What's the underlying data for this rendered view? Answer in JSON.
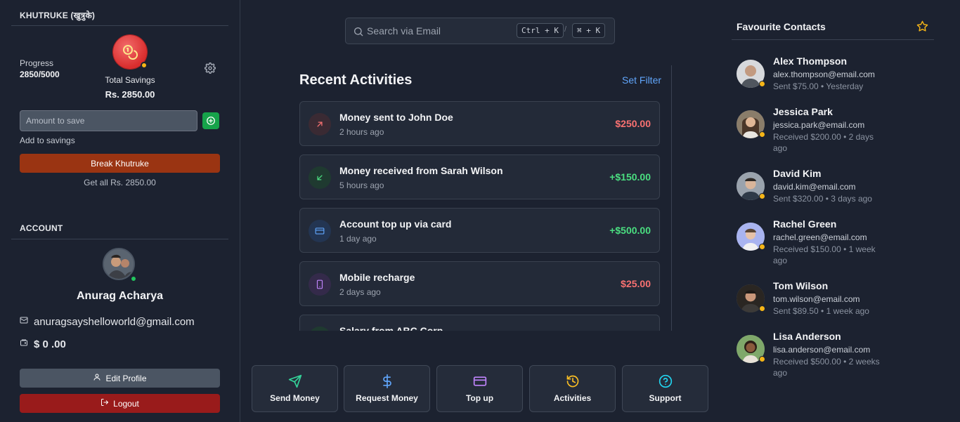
{
  "savings": {
    "section_title": "KHUTRUKE (खुत्रुके)",
    "progress_label": "Progress",
    "progress_value": "2850/5000",
    "total_label": "Total Savings",
    "total_value": "Rs. 2850.00",
    "amount_placeholder": "Amount to save",
    "add_hint": "Add to savings",
    "break_label": "Break Khutruke",
    "get_all": "Get all Rs. 2850.00",
    "coin_color": "#d92d2d"
  },
  "account": {
    "section_title": "ACCOUNT",
    "name": "Anurag Acharya",
    "email": "anuragsayshelloworld@gmail.com",
    "balance": "$ 0 .00",
    "edit_label": "Edit Profile",
    "logout_label": "Logout",
    "online_color": "#22c55e"
  },
  "search": {
    "placeholder": "Search via Email",
    "shortcut_win": "Ctrl + K",
    "shortcut_sep": "/",
    "shortcut_mac": "⌘ + K"
  },
  "recent": {
    "title": "Recent Activities",
    "filter_label": "Set Filter",
    "items": [
      {
        "title": "Money sent to John Doe",
        "time": "2 hours ago",
        "amount": "$250.00",
        "kind": "sent",
        "icon": "arrow-up-right-icon",
        "color": "#f87171"
      },
      {
        "title": "Money received from Sarah Wilson",
        "time": "5 hours ago",
        "amount": "+$150.00",
        "kind": "received",
        "icon": "arrow-down-left-icon",
        "color": "#4ade80"
      },
      {
        "title": "Account top up via card",
        "time": "1 day ago",
        "amount": "+$500.00",
        "kind": "topup",
        "icon": "card-icon",
        "color": "#4ade80"
      },
      {
        "title": "Mobile recharge",
        "time": "2 days ago",
        "amount": "$25.00",
        "kind": "recharge",
        "icon": "mobile-icon",
        "color": "#f87171"
      },
      {
        "title": "Salary from ABC Corp",
        "time": "",
        "amount": "",
        "kind": "received",
        "icon": "arrow-down-left-icon",
        "color": "#4ade80"
      }
    ]
  },
  "quick_actions": [
    {
      "label": "Send Money",
      "icon": "send-icon",
      "color": "#34d399"
    },
    {
      "label": "Request Money",
      "icon": "dollar-icon",
      "color": "#60a5fa"
    },
    {
      "label": "Top up",
      "icon": "card-icon",
      "color": "#c084fc"
    },
    {
      "label": "Activities",
      "icon": "history-icon",
      "color": "#fbbf24"
    },
    {
      "label": "Support",
      "icon": "help-icon",
      "color": "#22d3ee"
    }
  ],
  "favourites": {
    "title": "Favourite Contacts",
    "star_color": "#f5b517",
    "contacts": [
      {
        "name": "Alex Thompson",
        "email": "alex.thompson@email.com",
        "status": "Sent $75.00 • Yesterday"
      },
      {
        "name": "Jessica Park",
        "email": "jessica.park@email.com",
        "status": "Received $200.00 • 2 days ago"
      },
      {
        "name": "David Kim",
        "email": "david.kim@email.com",
        "status": "Sent $320.00 • 3 days ago"
      },
      {
        "name": "Rachel Green",
        "email": "rachel.green@email.com",
        "status": "Received $150.00 • 1 week ago"
      },
      {
        "name": "Tom Wilson",
        "email": "tom.wilson@email.com",
        "status": "Sent $89.50 • 1 week ago"
      },
      {
        "name": "Lisa Anderson",
        "email": "lisa.anderson@email.com",
        "status": "Received $500.00 • 2 weeks ago"
      }
    ]
  }
}
